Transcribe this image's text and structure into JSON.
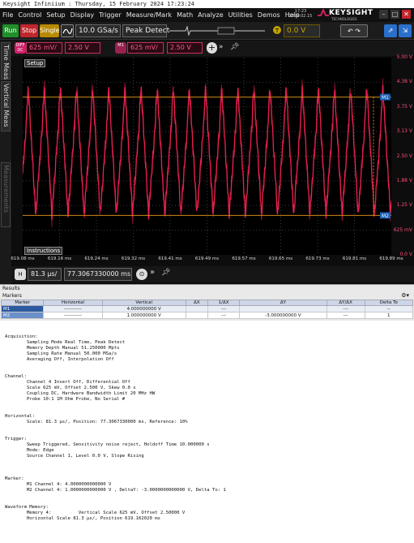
{
  "window_title": "Keysight Infiniium : Thursday, 15 February 2024 17:23:24",
  "menu": [
    "File",
    "Control",
    "Setup",
    "Display",
    "Trigger",
    "Measure/Mark",
    "Math",
    "Analyze",
    "Utilities",
    "Demos",
    "Help"
  ],
  "clock": {
    "time": "17:23",
    "date": "2024.02.15"
  },
  "brand": {
    "name": "KEYSIGHT",
    "sub": "TECHNOLOGIES"
  },
  "toolbar": {
    "run": "Run",
    "stop": "Stop",
    "single": "Single",
    "sample_rate": "10.0 GSa/s",
    "acq_mode": "Peak Detect",
    "trigger_level": "0.0 V"
  },
  "side_tabs": [
    "Time Meas",
    "Vertical Meas",
    "Measurements"
  ],
  "channels": [
    {
      "badge": "DIFF DC",
      "scale": "625 mV/",
      "offset": "2.50 V"
    },
    {
      "badge": "M1",
      "scale": "625 mV/",
      "offset": "2.50 V"
    }
  ],
  "plot": {
    "setup_label": "Setup",
    "instructions_label": "Instructions",
    "y_labels": [
      "5.00 V",
      "4.38 V",
      "3.75 V",
      "3.13 V",
      "2.50 V",
      "1.88 V",
      "1.25 V",
      "625 mV",
      "0.0 V"
    ],
    "x_labels": [
      "619.08 ms",
      "619.16 ms",
      "619.24 ms",
      "619.32 ms",
      "619.41 ms",
      "619.49 ms",
      "619.57 ms",
      "619.65 ms",
      "619.73 ms",
      "619.81 ms",
      "619.89 ms"
    ],
    "marker_labels": [
      "M1",
      "M2"
    ],
    "colors": {
      "trace": "#e8204f",
      "marker": "#d28a18",
      "grid": "#3a3a3a",
      "marker_tag": "#1a5fb4"
    }
  },
  "horizontal": {
    "badge": "H",
    "scale": "81.3 µs/",
    "position": "77.3067330000 ms"
  },
  "results": {
    "heading": "Results",
    "markers_heading": "Markers",
    "columns": [
      "Marker",
      "Horizontal",
      "Vertical",
      "ΔX",
      "1/ΔX",
      "ΔY",
      "ΔY/ΔX",
      "Delta To"
    ],
    "rows": [
      [
        "M1",
        "-----------",
        "4.000000000 V",
        "",
        "---",
        "",
        "---",
        "--"
      ],
      [
        "M2",
        "-----------",
        "1.000000000 V",
        "",
        "---",
        "-3.000000000 V",
        "---",
        "1"
      ]
    ]
  },
  "report": [
    "Acquisition:",
    "        Sampling Mode Real Time, Peak Detect",
    "        Memory Depth Manual 51.250000 Mpts",
    "        Sampling Rate Manual 50.000 MSa/s",
    "        Averaging Off, Interpolation Off",
    "",
    "",
    "Channel:",
    "        Channel 4 Invert Off, Differential Off",
    "        Scale 625 mV, Offset 2.500 V, Skew 0.0 s",
    "        Coupling DC, Hardware Bandwidth Limit 20 MHz HW",
    "        Probe 10:1 1M Ohm Probe, No Serial #",
    "",
    "",
    "Horizontal:",
    "        Scale: 81.3 µs/, Position: 77.3067330000 ms, Reference: 10%",
    "",
    "",
    "Trigger:",
    "        Sweep Triggered, Sensitivity noise reject, Holdoff Time 10.000000 s",
    "        Mode: Edge",
    "        Source Channel 1, Level 0.0 V, Slope Rising",
    "",
    "",
    "",
    "Marker:",
    "        M1 Channel 4: 4.0000000000000 V",
    "        M2 Channel 4: 1.0000000000000 V , DeltaY: -3.0000000000000 V, Delta To: 1",
    "",
    "",
    "Waveform Memory:",
    "        Memory 4:          Vertical Scale 625 mV, Offset 2.50000 V",
    "        Horizontal Scale 81.3 µs/, Position 619.162020 ms"
  ]
}
